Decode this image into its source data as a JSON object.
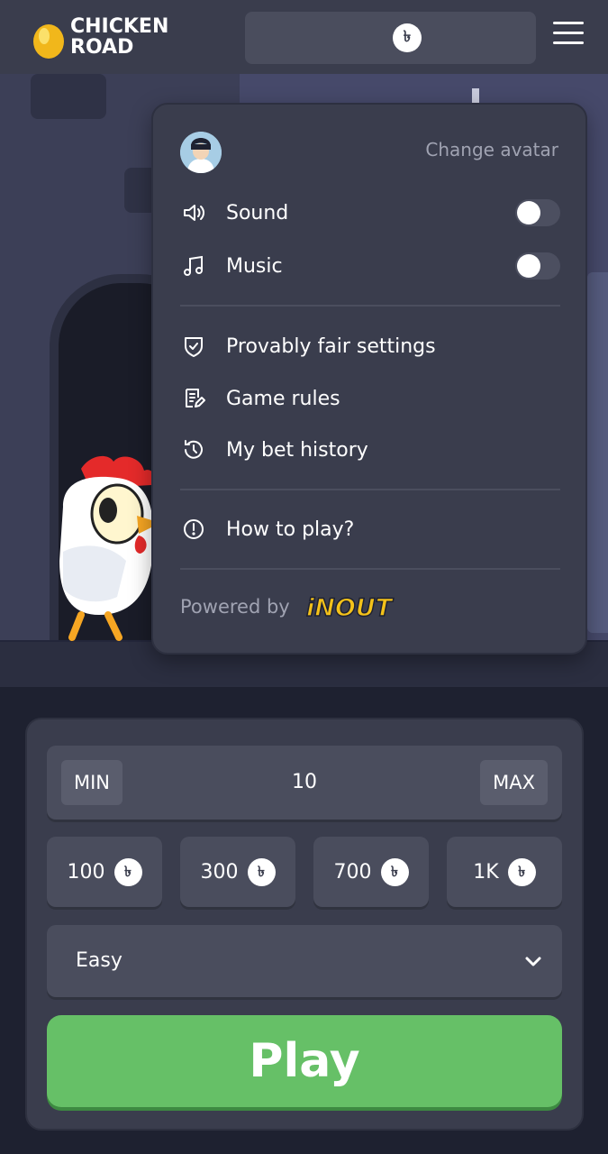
{
  "header": {
    "logo_line1": "CHICKEN",
    "logo_line2": "ROAD",
    "currency_symbol": "৳"
  },
  "menu": {
    "change_avatar": "Change avatar",
    "sound_label": "Sound",
    "sound_on": false,
    "music_label": "Music",
    "music_on": false,
    "provably_fair": "Provably fair settings",
    "game_rules": "Game rules",
    "bet_history": "My bet history",
    "how_to_play": "How to play?",
    "powered_by": "Powered by",
    "brand": "iNOUT"
  },
  "bet": {
    "min_label": "MIN",
    "value": "10",
    "max_label": "MAX",
    "chips": [
      "100",
      "300",
      "700",
      "1K"
    ],
    "currency_symbol": "৳"
  },
  "difficulty": {
    "selected": "Easy"
  },
  "play_label": "Play",
  "colors": {
    "play": "#66c067",
    "panel": "#3a3d4d",
    "brand_yellow": "#f4c21a"
  }
}
